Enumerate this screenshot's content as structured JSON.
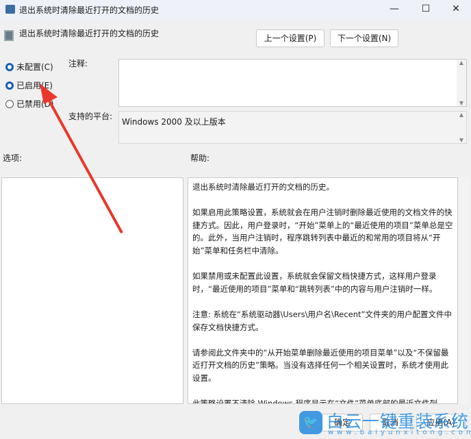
{
  "window": {
    "title": "退出系统时清除最近打开的文档的历史",
    "minimize": "—",
    "maximize": "☐",
    "close": "✕"
  },
  "header": {
    "policy_name": "退出系统时清除最近打开的文档的历史",
    "prev_label": "上一个设置(P)",
    "next_label": "下一个设置(N)"
  },
  "state": {
    "options": [
      {
        "label": "未配置(C)",
        "selected": false
      },
      {
        "label": "已启用(E)",
        "selected": true
      },
      {
        "label": "已禁用(D)",
        "selected": false
      }
    ]
  },
  "comment": {
    "label": "注释:",
    "value": ""
  },
  "platform": {
    "label": "支持的平台:",
    "value": "Windows 2000 及以上版本"
  },
  "options_label": "选项:",
  "help_label": "帮助:",
  "help_paragraphs": [
    "退出系统时清除最近打开的文档的历史。",
    "如果启用此策略设置，系统就会在用户注销时删除最近使用的文档文件的快捷方式。因此，用户登录时，“开始”菜单上的“最近使用的项目”菜单总是空的。此外，当用户注销时，程序跳转列表中最近的和常用的项目将从“开始”菜单和任务栏中清除。",
    "如果禁用或未配置此设置，系统就会保留文档快捷方式，这样用户登录时，“最近使用的项目”菜单和“跳转列表”中的内容与用户注销时一样。",
    "注意: 系统在“系统驱动器\\Users\\用户名\\Recent”文件夹的用户配置文件中保存文档快捷方式。",
    "请参阅此文件夹中的“从开始菜单删除最近使用的项目菜单”以及“不保留最近打开文档的历史”策略。当没有选择任何一个相关设置时，系统才使用此设置。",
    "此策略设置不清除 Windows 程序显示在“文件”菜单底部的最近文件列表。请参阅“不保留最近打开文档的历史”策略设置。"
  ],
  "footer": {
    "ok": "确定",
    "cancel": "取消",
    "apply": "应用(A)"
  },
  "watermark": {
    "name": "白云一键重装系统",
    "url": "www.baiyunxitong.com"
  },
  "colors": {
    "accent": "#1a5fb4",
    "arrow": "#e8382c",
    "watermark": "#2b8ee0"
  }
}
